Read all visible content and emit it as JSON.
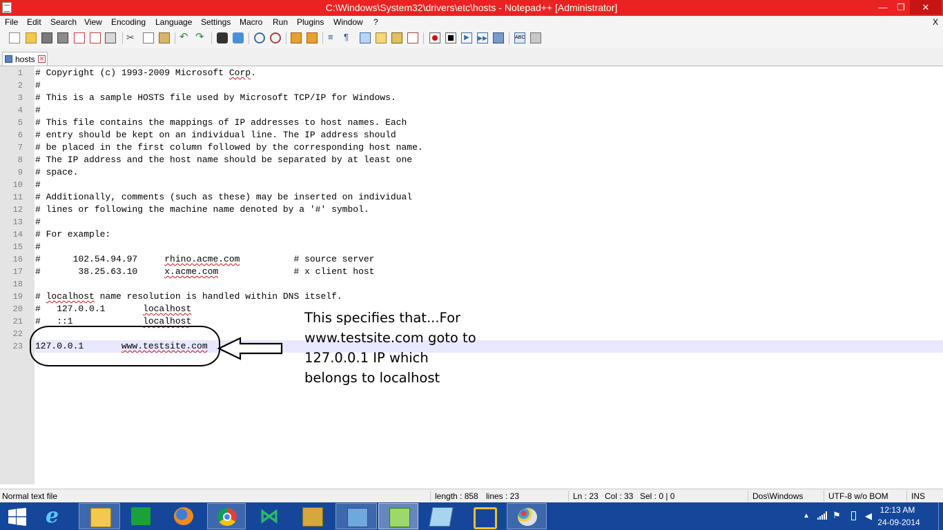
{
  "window": {
    "title": "C:\\Windows\\System32\\drivers\\etc\\hosts - Notepad++ [Administrator]",
    "minimize_glyph": "—",
    "maximize_glyph": "❐",
    "close_glyph": "✕",
    "title_bar_color": "#eb2222"
  },
  "menu": {
    "items": [
      "File",
      "Edit",
      "Search",
      "View",
      "Encoding",
      "Language",
      "Settings",
      "Macro",
      "Run",
      "Plugins",
      "Window",
      "?"
    ],
    "close_doc": "X"
  },
  "toolbar": {
    "icons": [
      "new-file-icon",
      "open-file-icon",
      "save-icon",
      "save-all-icon",
      "close-icon",
      "close-all-icon",
      "print-icon",
      "cut-icon",
      "copy-icon",
      "paste-icon",
      "undo-icon",
      "redo-icon",
      "find-icon",
      "replace-icon",
      "zoom-in-icon",
      "zoom-out-icon",
      "sync-vertical-icon",
      "sync-horizontal-icon",
      "word-wrap-icon",
      "show-all-chars-icon",
      "indent-guide-icon",
      "user-language-icon",
      "doc-map-icon",
      "function-list-icon",
      "record-macro-icon",
      "stop-record-icon",
      "play-macro-icon",
      "run-macro-multiple-icon",
      "save-macro-icon",
      "spell-check-icon",
      "settings-icon"
    ]
  },
  "tabs": [
    {
      "label": "hosts",
      "close": "✕"
    }
  ],
  "editor": {
    "lines": [
      {
        "num": "1",
        "text": "# Copyright (c) 1993-2009 Microsoft Corp."
      },
      {
        "num": "2",
        "text": "#"
      },
      {
        "num": "3",
        "text": "# This is a sample HOSTS file used by Microsoft TCP/IP for Windows."
      },
      {
        "num": "4",
        "text": "#"
      },
      {
        "num": "5",
        "text": "# This file contains the mappings of IP addresses to host names. Each"
      },
      {
        "num": "6",
        "text": "# entry should be kept on an individual line. The IP address should"
      },
      {
        "num": "7",
        "text": "# be placed in the first column followed by the corresponding host name."
      },
      {
        "num": "8",
        "text": "# The IP address and the host name should be separated by at least one"
      },
      {
        "num": "9",
        "text": "# space."
      },
      {
        "num": "10",
        "text": "#"
      },
      {
        "num": "11",
        "text": "# Additionally, comments (such as these) may be inserted on individual"
      },
      {
        "num": "12",
        "text": "# lines or following the machine name denoted by a '#' symbol."
      },
      {
        "num": "13",
        "text": "#"
      },
      {
        "num": "14",
        "text": "# For example:"
      },
      {
        "num": "15",
        "text": "#"
      },
      {
        "num": "16",
        "text": "#      102.54.94.97     rhino.acme.com          # source server"
      },
      {
        "num": "17",
        "text": "#       38.25.63.10     x.acme.com              # x client host"
      },
      {
        "num": "18",
        "text": ""
      },
      {
        "num": "19",
        "text": "# localhost name resolution is handled within DNS itself."
      },
      {
        "num": "20",
        "text": "#   127.0.0.1       localhost"
      },
      {
        "num": "21",
        "text": "#   ::1             localhost"
      },
      {
        "num": "22",
        "text": ""
      },
      {
        "num": "23",
        "text": "127.0.0.1       www.testsite.com"
      }
    ]
  },
  "annotation": {
    "text": "This specifies that...For www.testsite.com goto to 127.0.0.1 IP which belongs to localhost"
  },
  "status": {
    "filetype": "Normal text file",
    "length": "length : 858",
    "lines": "lines : 23",
    "ln": "Ln : 23",
    "col": "Col : 33",
    "sel": "Sel : 0 | 0",
    "eol": "Dos\\Windows",
    "encoding": "UTF-8 w/o BOM",
    "mode": "INS"
  },
  "taskbar": {
    "apps": [
      "start-icon",
      "internet-explorer-icon",
      "file-explorer-icon",
      "store-icon",
      "firefox-icon",
      "chrome-icon",
      "visual-studio-icon",
      "tools-icon",
      "network-icon",
      "notepad-plus-plus-icon",
      "notepad-icon",
      "vmware-icon",
      "paint-icon"
    ],
    "active_app": "notepad-plus-plus-icon",
    "time": "12:13 AM",
    "date": "24-09-2014",
    "taskbar_color": "#14479a"
  }
}
